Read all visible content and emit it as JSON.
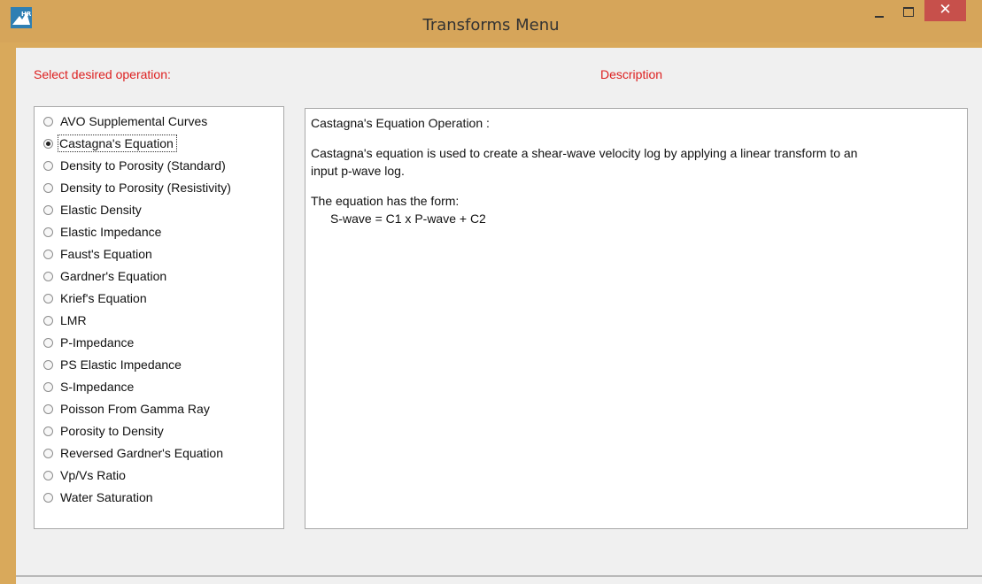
{
  "window": {
    "title": "Transforms Menu",
    "close_glyph": "✕",
    "app_icon": "HR-logo-icon"
  },
  "headings": {
    "select": "Select desired operation:",
    "description": "Description"
  },
  "operations": [
    {
      "label": "AVO Supplemental Curves",
      "checked": false
    },
    {
      "label": "Castagna's Equation",
      "checked": true
    },
    {
      "label": "Density to Porosity (Standard)",
      "checked": false
    },
    {
      "label": "Density to Porosity (Resistivity)",
      "checked": false
    },
    {
      "label": "Elastic Density",
      "checked": false
    },
    {
      "label": "Elastic Impedance",
      "checked": false
    },
    {
      "label": "Faust's Equation",
      "checked": false
    },
    {
      "label": "Gardner's Equation",
      "checked": false
    },
    {
      "label": "Krief's Equation",
      "checked": false
    },
    {
      "label": "LMR",
      "checked": false
    },
    {
      "label": "P-Impedance",
      "checked": false
    },
    {
      "label": "PS Elastic Impedance",
      "checked": false
    },
    {
      "label": "S-Impedance",
      "checked": false
    },
    {
      "label": "Poisson From Gamma Ray",
      "checked": false
    },
    {
      "label": "Porosity to Density",
      "checked": false
    },
    {
      "label": "Reversed Gardner's Equation",
      "checked": false
    },
    {
      "label": "Vp/Vs Ratio",
      "checked": false
    },
    {
      "label": "Water Saturation",
      "checked": false
    }
  ],
  "description": {
    "title": "Castagna's Equation Operation :",
    "line1": "Castagna's equation is used to create a shear-wave velocity log by applying a linear transform to an",
    "line2": "input p-wave log.",
    "line3": "The equation has the form:",
    "line4": "S-wave = C1 x P-wave + C2"
  },
  "colors": {
    "frame": "#d9a95b",
    "heading": "#dd1f1f",
    "close": "#c7504b"
  }
}
